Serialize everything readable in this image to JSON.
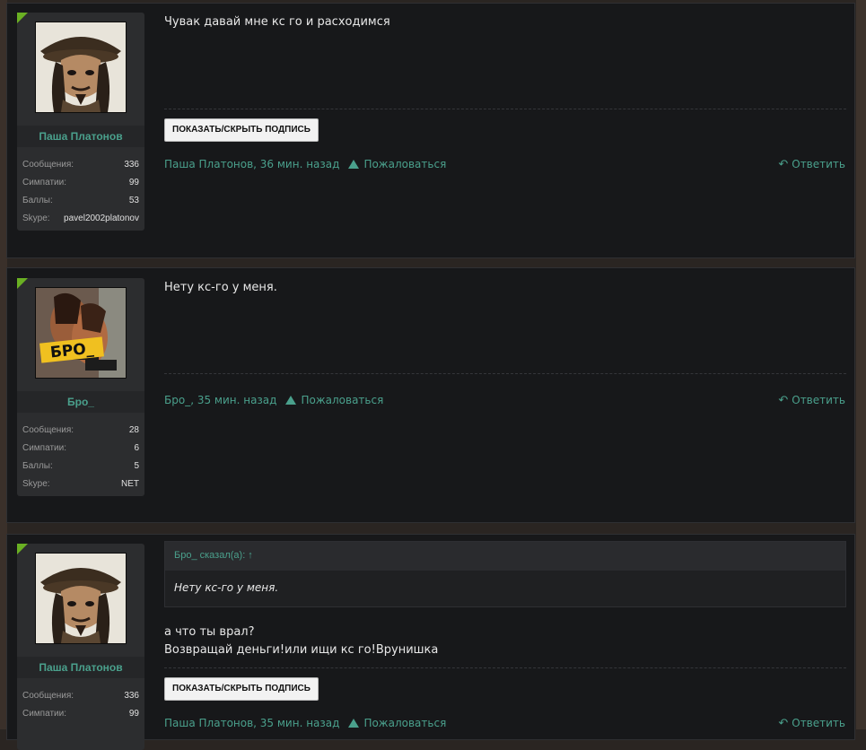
{
  "posts": [
    {
      "user": {
        "name": "Паша Платонов",
        "avatar_icon": "pirate-avatar",
        "stats": [
          {
            "label": "Сообщения:",
            "value": "336"
          },
          {
            "label": "Симпатии:",
            "value": "99"
          },
          {
            "label": "Баллы:",
            "value": "53"
          },
          {
            "label": "Skype:",
            "value": "pavel2002platonov"
          }
        ]
      },
      "message": "Чувак давай мне кс го и расходимся",
      "signature_button": "ПОКАЗАТЬ/СКРЫТЬ ПОДПИСЬ",
      "meta": "Паша Платонов, 36 мин. назад",
      "report": "Пожаловаться",
      "reply": "Ответить"
    },
    {
      "user": {
        "name": "Бро_",
        "avatar_icon": "photo-avatar",
        "avatar_text": "БРО_",
        "stats": [
          {
            "label": "Сообщения:",
            "value": "28"
          },
          {
            "label": "Симпатии:",
            "value": "6"
          },
          {
            "label": "Баллы:",
            "value": "5"
          },
          {
            "label": "Skype:",
            "value": "NET"
          }
        ]
      },
      "message": "Нету кс-го у меня.",
      "meta": "Бро_, 35 мин. назад",
      "report": "Пожаловаться",
      "reply": "Ответить"
    },
    {
      "user": {
        "name": "Паша Платонов",
        "avatar_icon": "pirate-avatar",
        "stats": [
          {
            "label": "Сообщения:",
            "value": "336"
          },
          {
            "label": "Симпатии:",
            "value": "99"
          }
        ]
      },
      "quote": {
        "header": "Бро_ сказал(а): ↑",
        "text": "Нету кс-го у меня."
      },
      "message_lines": [
        "а что ты врал?",
        "Возвращай деньги!или ищи кс го!Врунишка"
      ],
      "signature_button": "ПОКАЗАТЬ/СКРЫТЬ ПОДПИСЬ",
      "meta": "Паша Платонов, 35 мин. назад",
      "report": "Пожаловаться",
      "reply": "Ответить"
    }
  ],
  "colors": {
    "accent": "#4aa08c",
    "corner": "#6ab023",
    "post_bg": "#17181a",
    "sidebar_bg": "#2c2d2f"
  }
}
